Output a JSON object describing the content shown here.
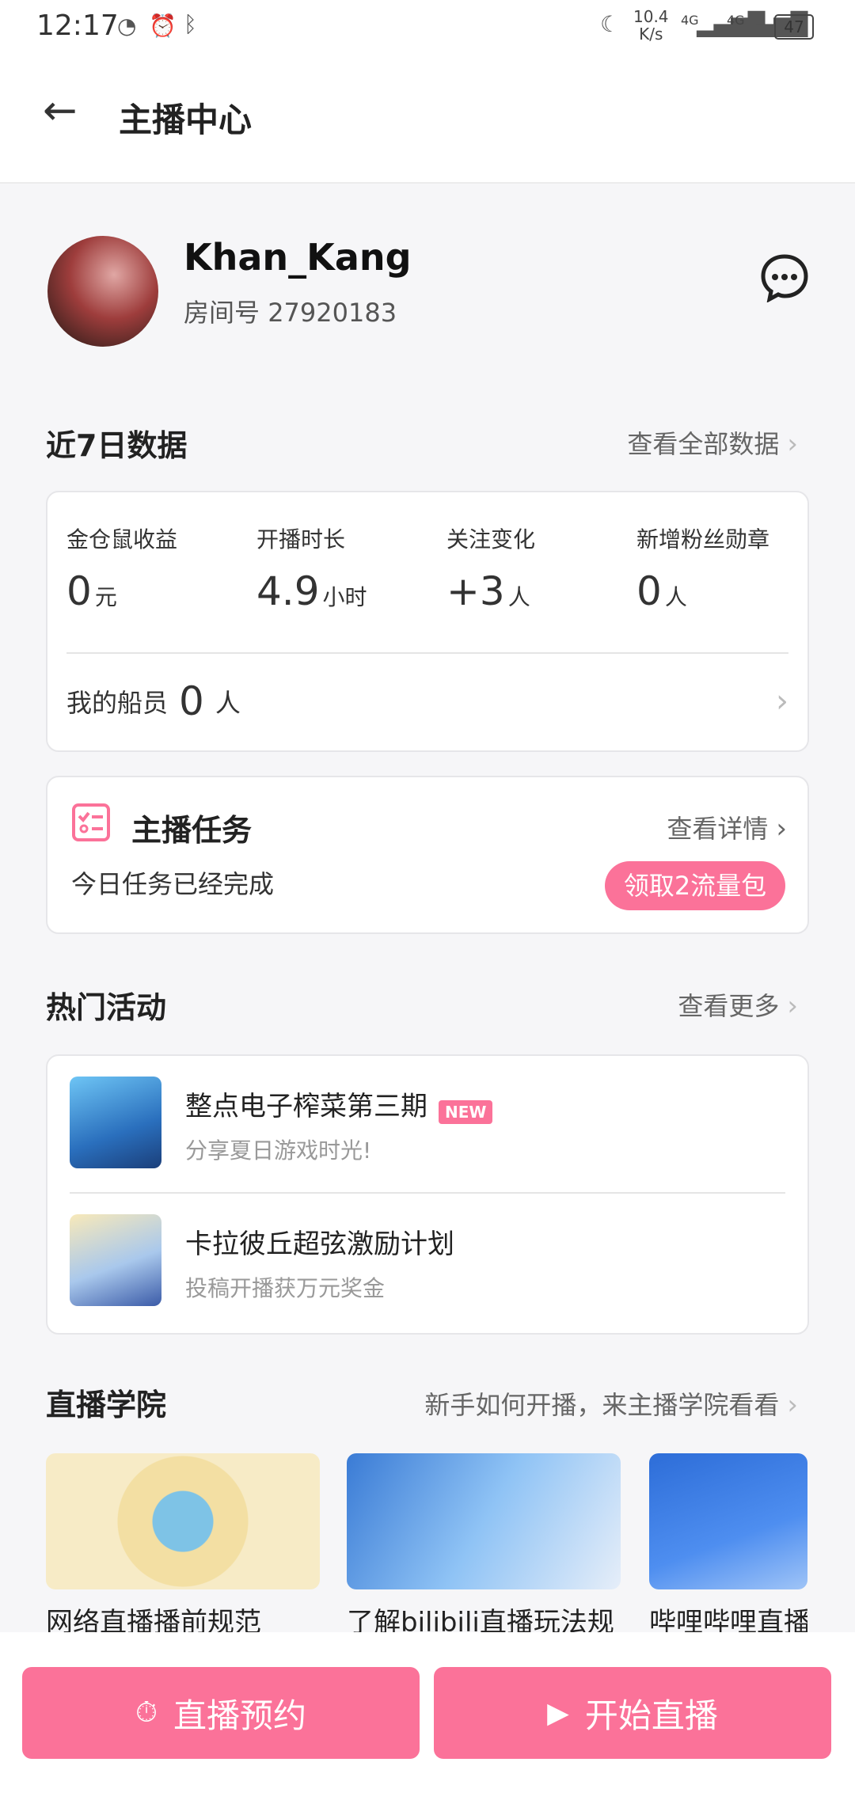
{
  "status_bar": {
    "time": "12:17",
    "speed_value": "10.4",
    "speed_unit": "K/s",
    "net1": "4G",
    "net2": "4G",
    "battery": "47"
  },
  "header": {
    "back_icon": "arrow-left-icon",
    "title": "主播中心"
  },
  "profile": {
    "username": "Khan_Kang",
    "room_label": "房间号",
    "room_number": "27920183",
    "message_icon": "chat-bubble-icon"
  },
  "weekly": {
    "title": "近7日数据",
    "link": "查看全部数据",
    "stats": [
      {
        "label": "金仓鼠收益",
        "value": "0",
        "unit": "元"
      },
      {
        "label": "开播时长",
        "value": "4.9",
        "unit": "小时"
      },
      {
        "label": "关注变化",
        "value": "+3",
        "unit": "人"
      },
      {
        "label": "新增粉丝勋章",
        "value": "0",
        "unit": "人"
      }
    ],
    "crew_label": "我的船员",
    "crew_value": "0",
    "crew_unit": "人"
  },
  "task": {
    "title": "主播任务",
    "link": "查看详情",
    "status": "今日任务已经完成",
    "button": "领取2流量包",
    "icon": "task-list-icon"
  },
  "activities": {
    "title": "热门活动",
    "link": "查看更多",
    "items": [
      {
        "title": "整点电子榨菜第三期",
        "badge": "NEW",
        "subtitle": "分享夏日游戏时光!"
      },
      {
        "title": "卡拉彼丘超弦激励计划",
        "badge": "",
        "subtitle": "投稿开播获万元奖金"
      }
    ]
  },
  "academy": {
    "title": "直播学院",
    "link": "新手如何开播，来主播学院看看",
    "items": [
      {
        "title": "网络直播播前规范"
      },
      {
        "title": "了解bilibili直播玩法规"
      },
      {
        "title": "哔哩哔哩直播"
      }
    ]
  },
  "bottom": {
    "reserve_label": "直播预约",
    "start_label": "开始直播"
  },
  "colors": {
    "accent": "#fb7299",
    "background": "#f6f6f8"
  }
}
